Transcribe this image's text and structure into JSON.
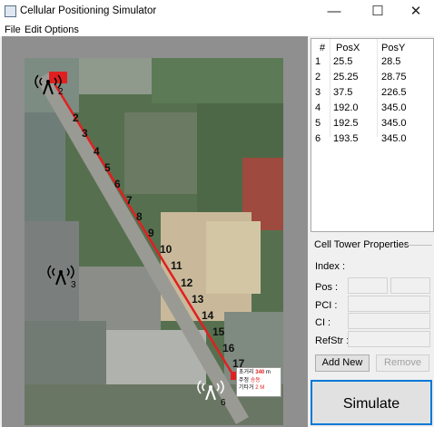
{
  "window": {
    "title": "Cellular Positioning Simulator",
    "minimize": "—",
    "maximize": "☐",
    "close": "✕"
  },
  "menu": [
    "File",
    "Edit",
    "Options"
  ],
  "map": {
    "towers": [
      "2",
      "3",
      "6"
    ],
    "path_points": [
      "2",
      "3",
      "4",
      "5",
      "6",
      "7",
      "8",
      "9",
      "10",
      "11",
      "12",
      "13",
      "14",
      "15",
      "16",
      "17"
    ],
    "popup": {
      "row1": "초거리",
      "dist": "340",
      "unit": "m",
      "row2": "주정",
      "row2b": "송동",
      "row3": "기타거",
      "row3b": "2",
      "row3c": "M"
    }
  },
  "table": {
    "headers": [
      "#",
      "PosX",
      "PosY"
    ],
    "rows": [
      {
        "id": "1",
        "x": "25.5",
        "y": "28.5"
      },
      {
        "id": "2",
        "x": "25.25",
        "y": "28.75"
      },
      {
        "id": "3",
        "x": "37.5",
        "y": "226.5"
      },
      {
        "id": "4",
        "x": "192.0",
        "y": "345.0"
      },
      {
        "id": "5",
        "x": "192.5",
        "y": "345.0"
      },
      {
        "id": "6",
        "x": "193.5",
        "y": "345.0"
      }
    ]
  },
  "props": {
    "title": "Cell Tower Properties",
    "index": "Index :",
    "pos": "Pos :",
    "pci": "PCI :",
    "ci": "CI :",
    "refstr": "RefStr :"
  },
  "buttons": {
    "add": "Add New",
    "remove": "Remove",
    "simulate": "Simulate"
  }
}
